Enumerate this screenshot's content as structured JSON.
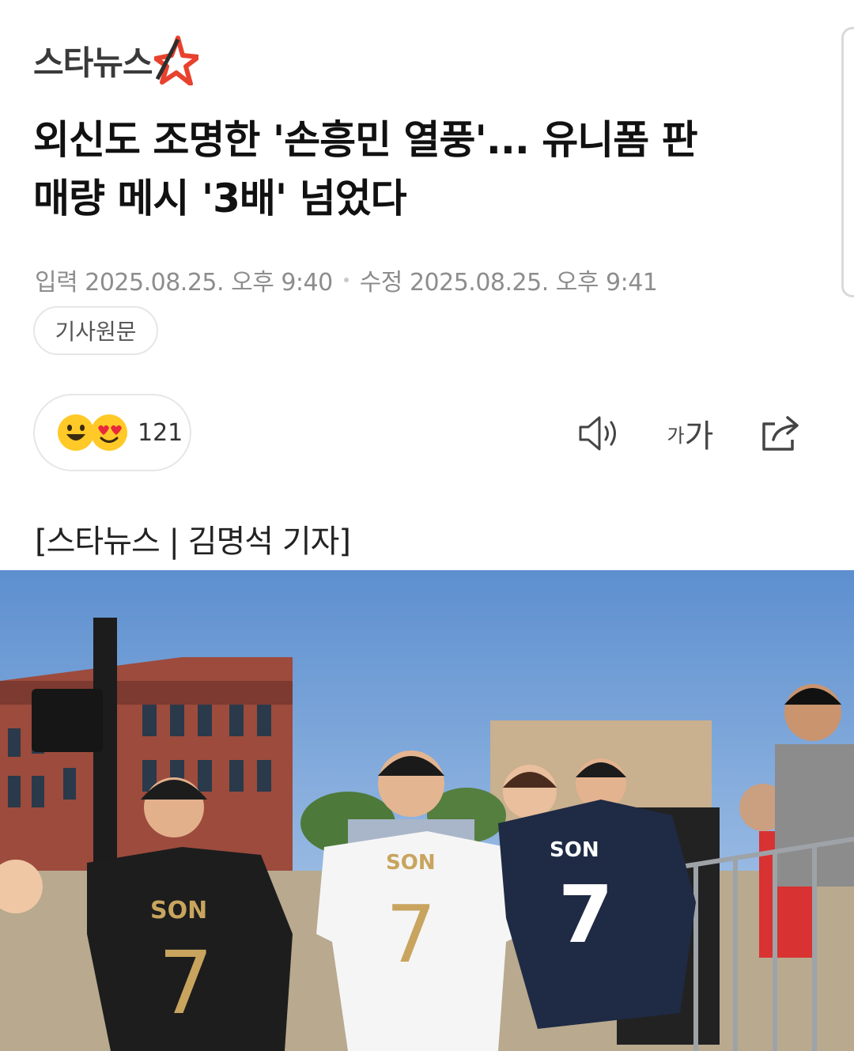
{
  "header": {
    "logo_text": "스타뉴스",
    "brand_color": "#e8422f"
  },
  "article": {
    "headline_line1": "외신도 조명한 '손흥민 열풍'... 유니폼 판",
    "headline_line2": "매량 메시 '3배' 넘었다",
    "input_label": "입력",
    "input_time": "2025.08.25. 오후 9:40",
    "edit_label": "수정",
    "edit_time": "2025.08.25. 오후 9:41",
    "original_button": "기사원문",
    "byline": "[스타뉴스 | 김명석 기자]"
  },
  "reactions": {
    "icons": [
      "smile-emoji-icon",
      "heart-eyes-emoji-icon"
    ],
    "count": "121"
  },
  "toolbar": {
    "audio_icon": "speaker-icon",
    "font_small": "가",
    "font_large": "가",
    "share_icon": "share-icon"
  },
  "photo": {
    "jersey_left_text": "SON",
    "jersey_left_number": "7",
    "jersey_middle_text": "SON",
    "jersey_middle_number": "7",
    "jersey_right_text": "SON",
    "jersey_right_number": "7"
  }
}
